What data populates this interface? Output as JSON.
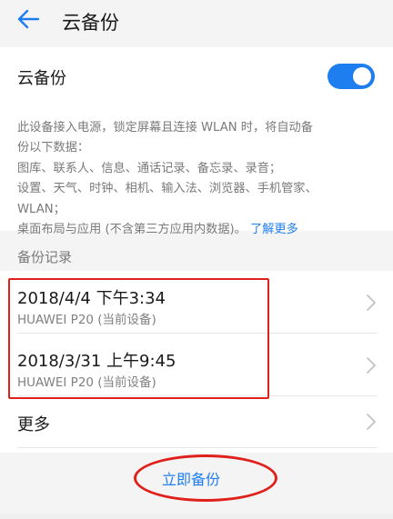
{
  "header": {
    "title": "云备份",
    "back_icon": "arrow-left-icon"
  },
  "settings": {
    "toggle_label": "云备份",
    "toggle_on": true,
    "accent_color": "#1e7ef0",
    "description_lines": [
      "此设备接入电源，锁定屏幕且连接 WLAN 时，将自动备",
      "份以下数据：",
      "图库、联系人、信息、通话记录、备忘录、录音；",
      "设置、天气、时钟、相机、输入法、浏览器、手机管家、",
      "WLAN；"
    ],
    "description_last": "桌面布局与应用 (不含第三方应用内数据)。",
    "learn_more": "了解更多"
  },
  "records_section": {
    "header": "备份记录",
    "records": [
      {
        "time": "2018/4/4 下午3:34",
        "device": "HUAWEI P20 (当前设备)"
      },
      {
        "time": "2018/3/31 上午9:45",
        "device": "HUAWEI P20 (当前设备)"
      }
    ],
    "more_label": "更多"
  },
  "actions": {
    "backup_now": "立即备份"
  },
  "annotation_color": "#e0201b"
}
